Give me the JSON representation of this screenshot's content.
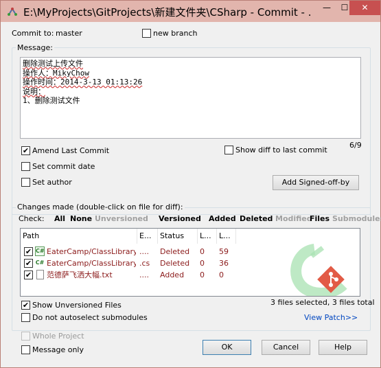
{
  "window": {
    "title": "E:\\MyProjects\\GitProjects\\新建文件夹\\CSharp - Commit - ...",
    "minimize_glyph": "—",
    "maximize_glyph": "☐",
    "close_glyph": "✕",
    "icon": "gitextensions-icon"
  },
  "commit_to": {
    "label": "Commit to:",
    "branch": "master"
  },
  "new_branch": {
    "label": "new branch",
    "checked": false
  },
  "message": {
    "group_label": "Message:",
    "lines": [
      "删除测试上传文件",
      "",
      "操作人：MikyChow",
      "操作时间：2014-3-13 01:13:26",
      "说明：",
      "1、删除测试文件"
    ],
    "counter": "6/9"
  },
  "options": {
    "amend": {
      "label": "Amend Last Commit",
      "checked": true
    },
    "show_diff": {
      "label": "Show diff to last commit",
      "checked": false
    },
    "set_commit_date": {
      "label": "Set commit date",
      "checked": false
    },
    "set_author": {
      "label": "Set author",
      "checked": false
    },
    "signed_off_button": "Add Signed-off-by"
  },
  "changes": {
    "group_label": "Changes made (double-click on file for diff):",
    "check_label": "Check:",
    "filters": [
      {
        "label": "All",
        "enabled": true
      },
      {
        "label": "None",
        "enabled": true
      },
      {
        "label": "Unversioned",
        "enabled": false
      },
      {
        "label": "Versioned",
        "enabled": true
      },
      {
        "label": "Added",
        "enabled": true
      },
      {
        "label": "Deleted",
        "enabled": true
      },
      {
        "label": "Modified",
        "enabled": false
      },
      {
        "label": "Files",
        "enabled": true
      },
      {
        "label": "Submodules",
        "enabled": false
      }
    ],
    "columns": [
      "Path",
      "E...",
      "Status",
      "L...",
      "L..."
    ],
    "rows": [
      {
        "checked": true,
        "icon": "csharp-file-icon",
        "path": "EaterCamp/ClassLibrary....",
        "ext": "....",
        "status": "Deleted",
        "added": "0",
        "removed": "59"
      },
      {
        "checked": true,
        "icon": "csharp-file-icon",
        "path": "EaterCamp/ClassLibrary....",
        "ext": ".cs",
        "status": "Deleted",
        "added": "0",
        "removed": "36"
      },
      {
        "checked": true,
        "icon": "text-file-icon",
        "path": "范德萨飞洒大幅.txt",
        "ext": "....",
        "status": "Added",
        "added": "0",
        "removed": "0"
      }
    ],
    "show_unversioned": {
      "label": "Show Unversioned Files",
      "checked": true
    },
    "no_autoselect": {
      "label": "Do not autoselect submodules",
      "checked": false
    },
    "selection_summary": "3 files selected, 3 files total",
    "view_patch": "View Patch>>"
  },
  "footer": {
    "whole_project": {
      "label": "Whole Project",
      "checked": false,
      "enabled": false
    },
    "message_only": {
      "label": "Message only",
      "checked": false
    },
    "ok": "OK",
    "cancel": "Cancel",
    "help": "Help"
  },
  "colors": {
    "titlebar": "#e2b5ad",
    "close_button": "#c75050",
    "path_text": "#8b1a1a",
    "link": "#0046c0",
    "git_logo_green": "#8fd8a0",
    "git_logo_red": "#e25b46"
  }
}
